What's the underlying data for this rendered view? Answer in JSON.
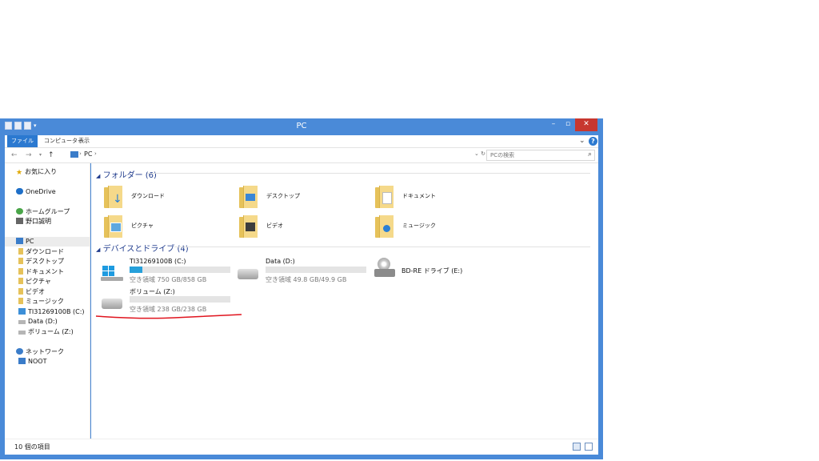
{
  "window": {
    "title": "PC"
  },
  "ribbon": {
    "tabs": [
      "ファイル",
      "コンピューター",
      "表示"
    ]
  },
  "address": {
    "crumbs": [
      "PC"
    ],
    "search_placeholder": "PCの検索"
  },
  "sidebar": {
    "favorites": "お気に入り",
    "onedrive": "OneDrive",
    "homegroup": "ホームグループ",
    "homegroup_user": "野口誠明",
    "pc": "PC",
    "pc_children": [
      "ダウンロード",
      "デスクトップ",
      "ドキュメント",
      "ピクチャ",
      "ビデオ",
      "ミュージック",
      "TI31269100B (C:)",
      "Data (D:)",
      "ボリューム (Z:)"
    ],
    "network": "ネットワーク",
    "network_node": "NOOT"
  },
  "folders": {
    "header": "フォルダー (6)",
    "items": [
      "ダウンロード",
      "デスクトップ",
      "ドキュメント",
      "ピクチャ",
      "ビデオ",
      "ミュージック"
    ]
  },
  "drives": {
    "header": "デバイスとドライブ (4)",
    "c": {
      "name": "TI31269100B (C:)",
      "free": "空き領域 750 GB/858 GB",
      "used_fraction": 0.13
    },
    "d": {
      "name": "Data (D:)",
      "free": "空き領域 49.8 GB/49.9 GB",
      "used_fraction": 0.0
    },
    "e": {
      "name": "BD-RE ドライブ (E:)"
    },
    "z": {
      "name": "ボリューム (Z:)",
      "free": "空き領域 238 GB/238 GB",
      "used_fraction": 0.0
    }
  },
  "status": {
    "count": "10 個の項目"
  },
  "colors": {
    "accent": "#2b79d0",
    "frame": "#4a8ad8",
    "close": "#c7372f",
    "usage": "#26a0da",
    "annotation": "#e0141e"
  }
}
